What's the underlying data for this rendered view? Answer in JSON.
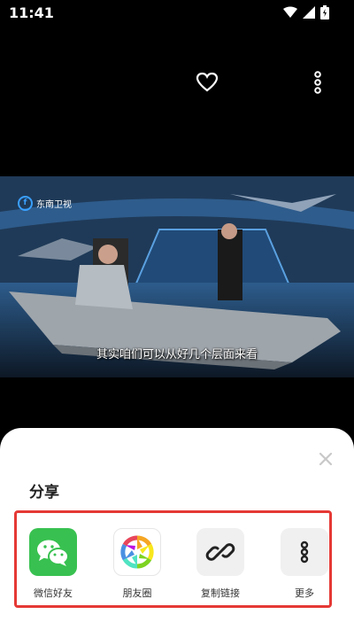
{
  "status": {
    "time": "11:41"
  },
  "video": {
    "channel": "东南卫视",
    "subtitle": "其实咱们可以从好几个层面来看"
  },
  "share_sheet": {
    "title": "分享",
    "items": [
      {
        "label": "微信好友",
        "icon": "wechat-icon"
      },
      {
        "label": "朋友圈",
        "icon": "moments-icon"
      },
      {
        "label": "复制链接",
        "icon": "link-icon"
      },
      {
        "label": "更多",
        "icon": "more-icon"
      }
    ]
  },
  "colors": {
    "wechat_green": "#38c150",
    "highlight_red": "#e53935"
  }
}
